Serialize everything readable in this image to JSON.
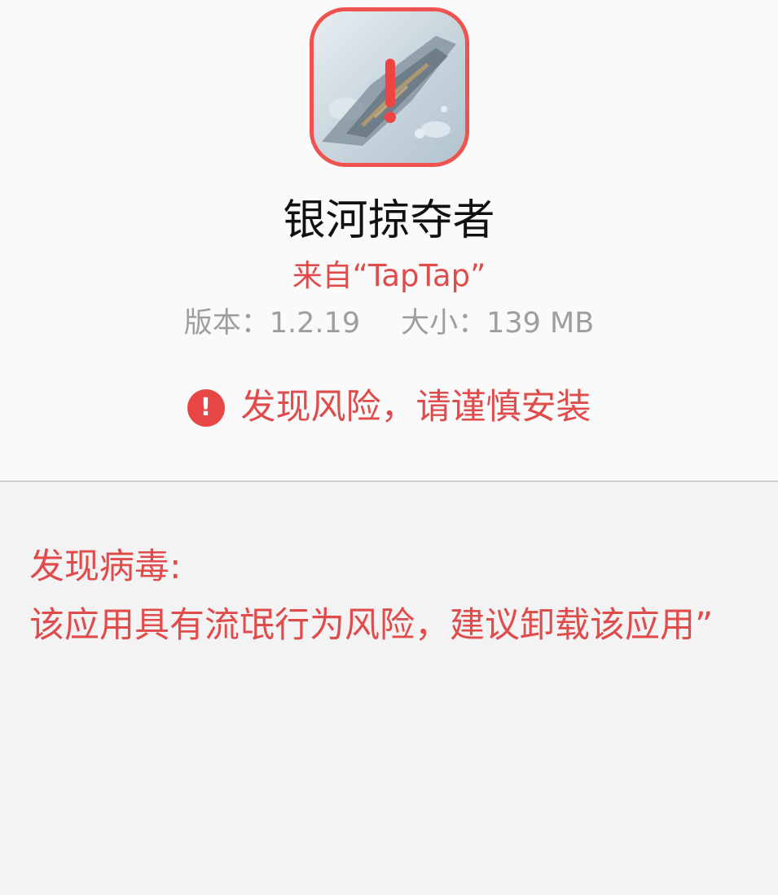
{
  "app": {
    "name": "银河掠夺者",
    "source": "来自“TapTap”",
    "version_label": "版本：1.2.19",
    "size_label": "大小：139 MB"
  },
  "risk": {
    "icon": "exclamation-circle-icon",
    "warning_text": "发现风险，请谨慎安装"
  },
  "detail": {
    "heading": "发现病毒:",
    "message": "该应用具有流氓行为风险，建议卸载该应用”"
  },
  "colors": {
    "accent_red": "#e04b4b",
    "icon_border": "#ef5350",
    "muted_gray": "#9e9e9e"
  }
}
